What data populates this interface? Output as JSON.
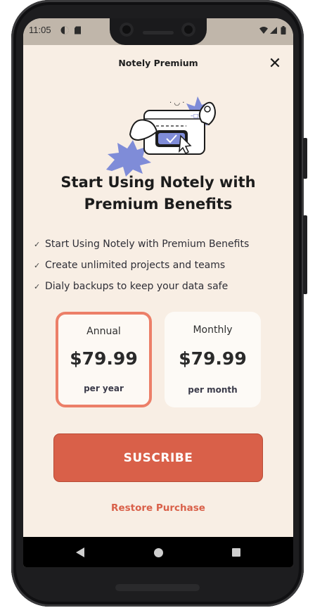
{
  "status_bar": {
    "time": "11:05"
  },
  "header": {
    "title": "Notely Premium"
  },
  "headline": "Start Using Notely with Premium Benefits",
  "features": [
    "Start Using Notely with Premium Benefits",
    "Create unlimited projects and teams",
    "Dialy backups to keep your data safe"
  ],
  "plans": [
    {
      "name": "Annual",
      "price": "$79.99",
      "period": "per year",
      "selected": true
    },
    {
      "name": "Monthly",
      "price": "$79.99",
      "period": "per month",
      "selected": false
    }
  ],
  "actions": {
    "subscribe_label": "SUSCRIBE",
    "restore_label": "Restore Purchase"
  },
  "colors": {
    "background": "#f8eee4",
    "accent": "#d96049",
    "selected_border": "#ec7f68",
    "illustration_blue": "#7f8cd8"
  },
  "icons": {
    "close": "close-icon",
    "check": "check-icon",
    "wifi": "wifi-icon",
    "battery": "battery-icon"
  }
}
